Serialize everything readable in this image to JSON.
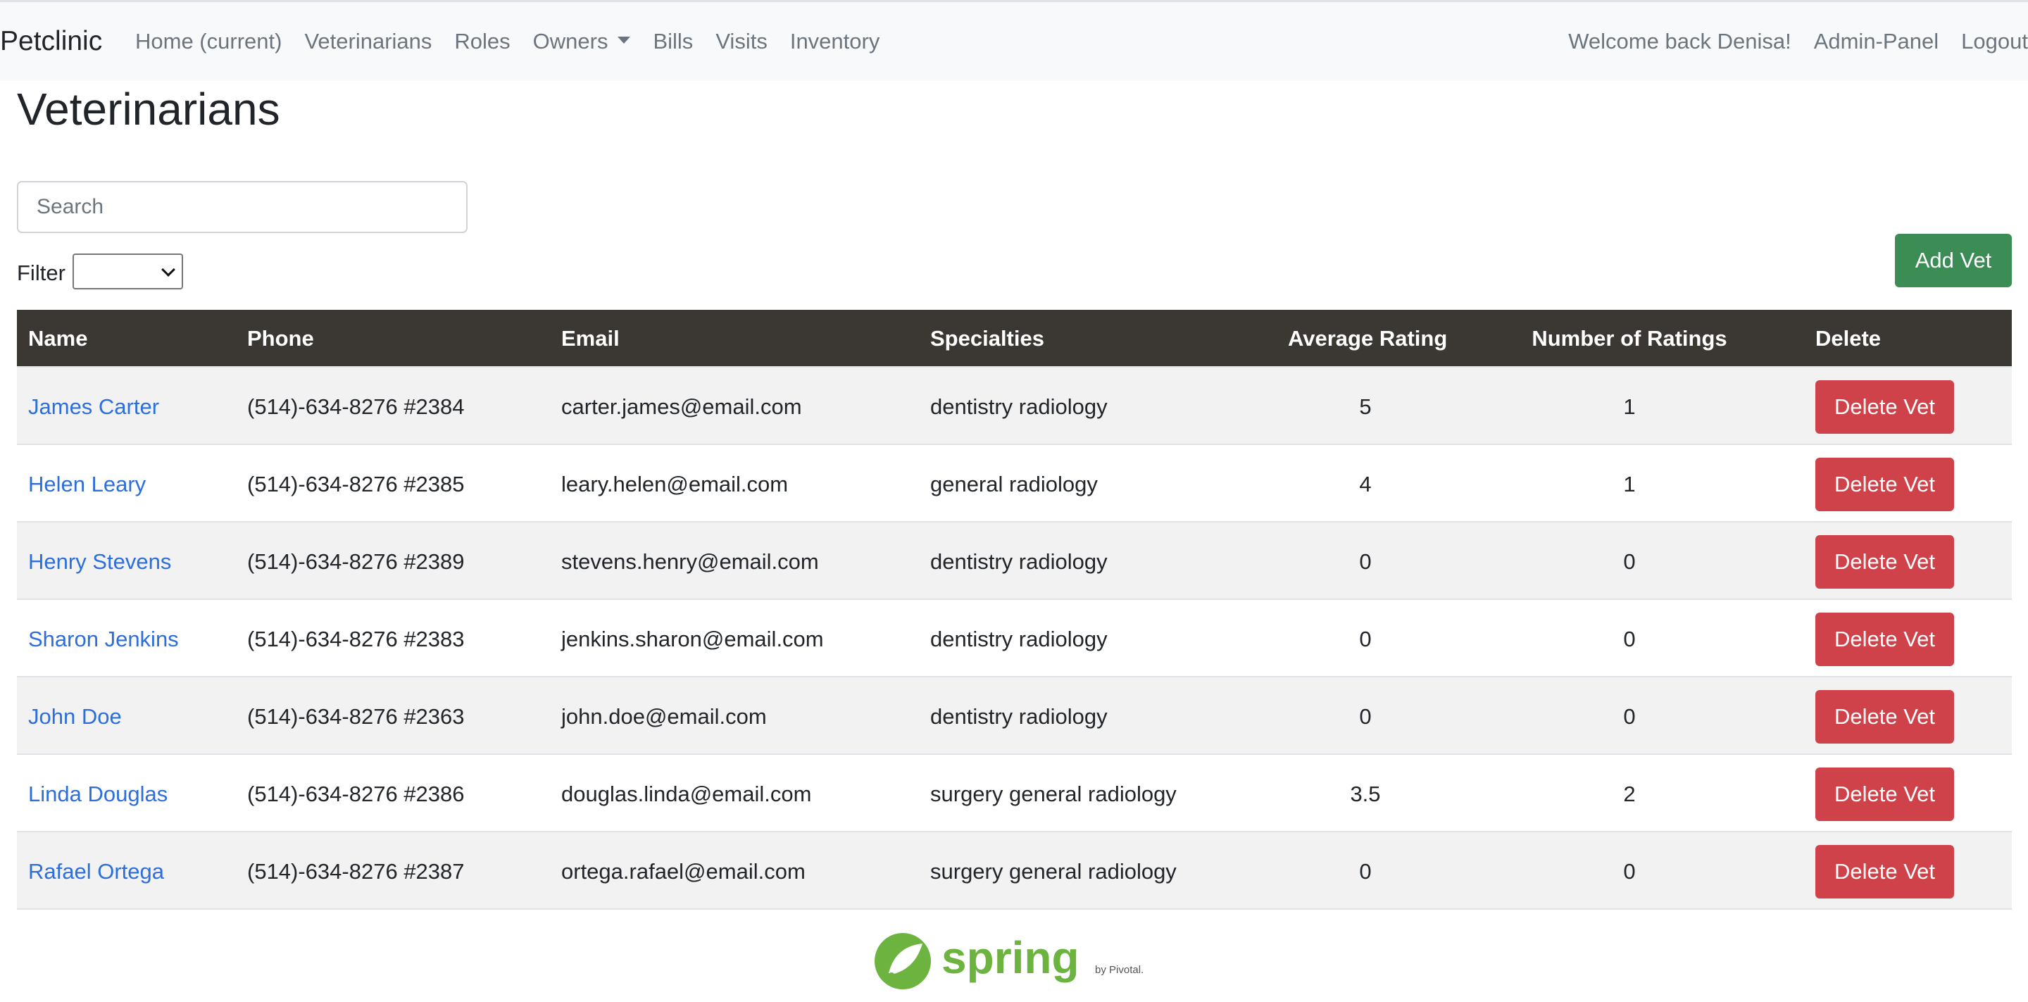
{
  "navbar": {
    "brand": "Petclinic",
    "links": [
      "Home (current)",
      "Veterinarians",
      "Roles",
      "Owners",
      "Bills",
      "Visits",
      "Inventory"
    ],
    "welcome": "Welcome back Denisa!",
    "admin": "Admin-Panel",
    "logout": "Logout"
  },
  "page": {
    "title": "Veterinarians",
    "search_placeholder": "Search",
    "filter_label": "Filter",
    "filter_value": "",
    "add_button": "Add Vet"
  },
  "table": {
    "headers": [
      "Name",
      "Phone",
      "Email",
      "Specialties",
      "Average Rating",
      "Number of Ratings",
      "Delete"
    ],
    "delete_label": "Delete Vet",
    "rows": [
      {
        "name": "James Carter",
        "phone": "(514)-634-8276 #2384",
        "email": "carter.james@email.com",
        "specialties": "dentistry radiology",
        "avg": "5",
        "num": "1"
      },
      {
        "name": "Helen Leary",
        "phone": "(514)-634-8276 #2385",
        "email": "leary.helen@email.com",
        "specialties": "general radiology",
        "avg": "4",
        "num": "1"
      },
      {
        "name": "Henry Stevens",
        "phone": "(514)-634-8276 #2389",
        "email": "stevens.henry@email.com",
        "specialties": "dentistry radiology",
        "avg": "0",
        "num": "0"
      },
      {
        "name": "Sharon Jenkins",
        "phone": "(514)-634-8276 #2383",
        "email": "jenkins.sharon@email.com",
        "specialties": "dentistry radiology",
        "avg": "0",
        "num": "0"
      },
      {
        "name": "John Doe",
        "phone": "(514)-634-8276 #2363",
        "email": "john.doe@email.com",
        "specialties": "dentistry radiology",
        "avg": "0",
        "num": "0"
      },
      {
        "name": "Linda Douglas",
        "phone": "(514)-634-8276 #2386",
        "email": "douglas.linda@email.com",
        "specialties": "surgery general radiology",
        "avg": "3.5",
        "num": "2"
      },
      {
        "name": "Rafael Ortega",
        "phone": "(514)-634-8276 #2387",
        "email": "ortega.rafael@email.com",
        "specialties": "surgery general radiology",
        "avg": "0",
        "num": "0"
      }
    ]
  },
  "footer": {
    "logo_text": "spring",
    "logo_sub": "by Pivotal.",
    "logo_color": "#6db33f"
  },
  "colors": {
    "add_button": "#3b8c55",
    "delete_button": "#d0424a",
    "table_header": "#3b3834",
    "link": "#2c6edb"
  }
}
